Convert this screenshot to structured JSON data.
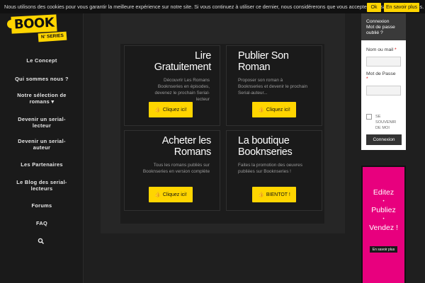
{
  "cookie_bar": {
    "text": "Nous utilisons des cookies pour vous garantir la meilleure expérience sur notre site. Si vous continuez à utiliser ce dernier, nous considérerons que vous acceptez l'utilisation des cookies.",
    "ok_label": "Ok",
    "more_label": "En savoir plus"
  },
  "logo": {
    "main": "BOOK",
    "sub": "N' SERIES"
  },
  "nav": {
    "items": [
      {
        "label": "Le Concept"
      },
      {
        "label": "Qui sommes nous ?"
      },
      {
        "label": "Notre sélection de romans ▾"
      },
      {
        "label": "Devenir un serial-lecteur"
      },
      {
        "label": "Devenir un serial-auteur"
      },
      {
        "label": "Les Partenaires"
      },
      {
        "label": "Le Blog des serial-lecteurs"
      },
      {
        "label": "Forums"
      },
      {
        "label": "FAQ"
      }
    ],
    "search_icon": "search-icon"
  },
  "cards": [
    {
      "title": "Lire Gratuitement",
      "desc": "Découvrir Les Romans Booknseries en épisodes, devenez le prochain Serial-lecteur",
      "button": "Cliquez ici!"
    },
    {
      "title": "Publier Son Roman",
      "desc": "Proposer son roman à Booknseries et devenir le prochain Serial-auteur...",
      "button": "Cliquez ici!"
    },
    {
      "title": "Acheter les Romans",
      "desc": "Tous les romans publiés sur Booknseries en version complète",
      "button": "Cliquez ici!"
    },
    {
      "title": "La boutique Booknseries",
      "desc": "Faites la promotion des oeuvres publiées sur Booknseries !",
      "button": "BIENTOT !"
    }
  ],
  "login": {
    "header_line1": "Connexion",
    "header_line2": "Mot de passe oublié ?",
    "username_label": "Nom ou mail",
    "password_label": "Mot de Passe",
    "required_mark": "*",
    "remember_label": "SE SOUVENIR DE MOI",
    "submit_label": "Connexion"
  },
  "ad": {
    "line1": "Editez",
    "line2": "Publiez",
    "line3": "Vendez !",
    "bullet": "•",
    "button": "En savoir plus"
  },
  "colors": {
    "accent": "#ffd500",
    "background": "#1f1f1f",
    "ad_pink": "#e8007e"
  }
}
